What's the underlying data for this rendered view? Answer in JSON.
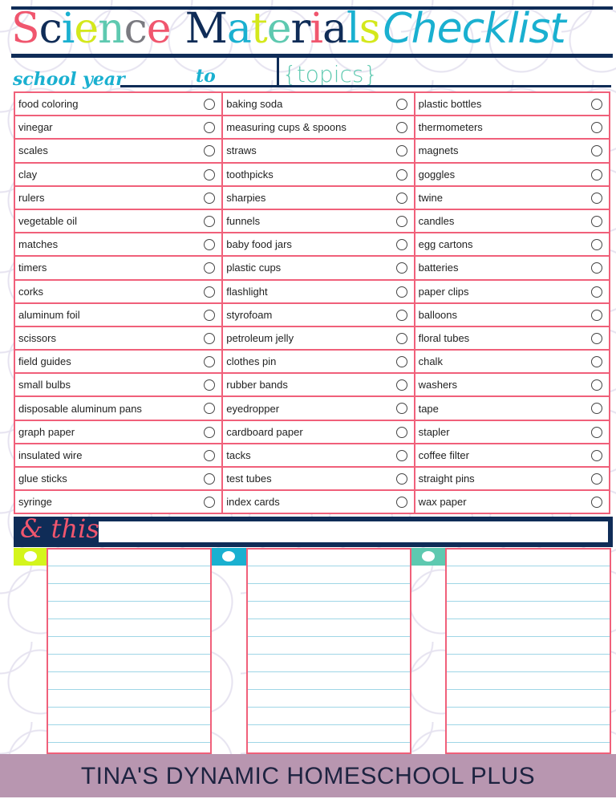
{
  "title": {
    "letters": [
      {
        "ch": "S",
        "color": "#f0566e"
      },
      {
        "ch": "c",
        "color": "#0f2c57"
      },
      {
        "ch": "i",
        "color": "#1ab0d0"
      },
      {
        "ch": "e",
        "color": "#d4e81c"
      },
      {
        "ch": "n",
        "color": "#5ec9b0"
      },
      {
        "ch": "c",
        "color": "#7a7a80"
      },
      {
        "ch": "e",
        "color": "#f0566e"
      },
      {
        "ch": " ",
        "color": "#000"
      },
      {
        "ch": "M",
        "color": "#0f2c57"
      },
      {
        "ch": "a",
        "color": "#1ab0d0"
      },
      {
        "ch": "t",
        "color": "#d4e81c"
      },
      {
        "ch": "e",
        "color": "#5ec9b0"
      },
      {
        "ch": "r",
        "color": "#0f2c57"
      },
      {
        "ch": "i",
        "color": "#f0566e"
      },
      {
        "ch": "a",
        "color": "#0f2c57"
      },
      {
        "ch": "l",
        "color": "#1ab0d0"
      },
      {
        "ch": "s",
        "color": "#d4e81c"
      },
      {
        "ch": "Checklist",
        "color": "#1ab0d0"
      }
    ]
  },
  "school_year_label": "school year",
  "to_label": "to",
  "topics_label": "{topics}",
  "checklist": [
    [
      "food coloring",
      "baking soda",
      "plastic bottles"
    ],
    [
      "vinegar",
      "measuring cups & spoons",
      "thermometers"
    ],
    [
      "scales",
      "straws",
      "magnets"
    ],
    [
      "clay",
      "toothpicks",
      "goggles"
    ],
    [
      "rulers",
      "sharpies",
      "twine"
    ],
    [
      "vegetable oil",
      "funnels",
      "candles"
    ],
    [
      "matches",
      "baby food jars",
      "egg cartons"
    ],
    [
      "timers",
      "plastic cups",
      "batteries"
    ],
    [
      "corks",
      "flashlight",
      "paper clips"
    ],
    [
      "aluminum foil",
      "styrofoam",
      "balloons"
    ],
    [
      "scissors",
      " petroleum jelly",
      "floral tubes"
    ],
    [
      "field guides",
      "clothes pin",
      "chalk"
    ],
    [
      "small bulbs",
      "rubber bands",
      "washers"
    ],
    [
      "disposable aluminum pans",
      "eyedropper",
      "tape"
    ],
    [
      "graph paper",
      "cardboard paper",
      "stapler"
    ],
    [
      "insulated wire",
      "tacks",
      "coffee filter"
    ],
    [
      "glue sticks",
      "test tubes",
      "straight pins"
    ],
    [
      "syringe",
      "index cards",
      "wax paper"
    ]
  ],
  "and_this_label": "& this",
  "note_tab_colors": [
    "#d4f51c",
    "#1ab0d0",
    "#5ec9b0"
  ],
  "footer": "TINA'S DYNAMIC HOMESCHOOL PLUS"
}
